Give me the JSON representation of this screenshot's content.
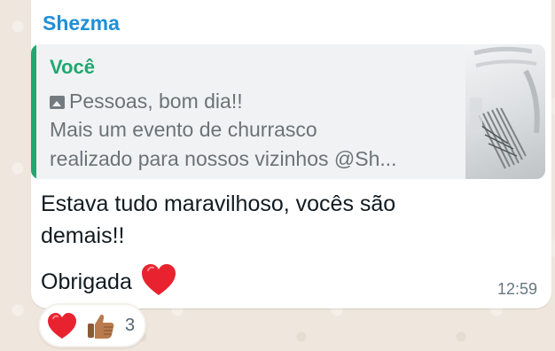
{
  "message": {
    "sender": "Shezma",
    "quoted": {
      "author": "Você",
      "lines": [
        "Pessoas, bom dia!!",
        "Mais um evento de churrasco",
        "realizado para nossos vizinhos @Sh..."
      ],
      "attachment_icon": "photo-icon"
    },
    "body_lines": [
      "Estava tudo maravilhoso, vocês são",
      "demais!!",
      "Obrigada"
    ],
    "time": "12:59"
  },
  "reactions": {
    "emojis": [
      "heart",
      "thumbs-up"
    ],
    "count": "3"
  },
  "colors": {
    "sender": "#1f8fd8",
    "quote_accent": "#1fa870",
    "wallpaper": "#efe7dd",
    "heart": "#e8232f"
  }
}
